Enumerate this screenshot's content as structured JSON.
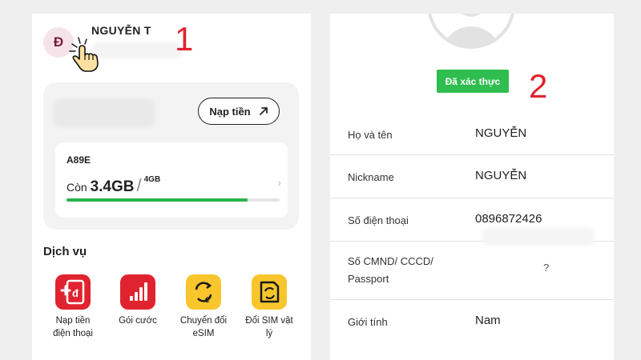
{
  "step_labels": [
    "1",
    "2"
  ],
  "panel1": {
    "avatar_initial": "Đ",
    "user_name": "NGUYỄN T",
    "topup_label": "Nạp tiền",
    "data_card": {
      "sim_code": "A89E",
      "remaining_prefix": "Còn",
      "remaining_value": "3.4GB",
      "total_value": "4GB",
      "progress_fraction": 0.85
    },
    "services_title": "Dịch vụ",
    "services": [
      {
        "label": "Nạp tiền\nđiện thoại",
        "icon": "topup-phone-icon",
        "color": "#e0242f"
      },
      {
        "label": "Gói cước",
        "icon": "signal-bars-icon",
        "color": "#e0242f"
      },
      {
        "label": "Chuyển đổi\neSIM",
        "icon": "esim-convert-icon",
        "color": "#f8c62c"
      },
      {
        "label": "Đổi SIM vật\nlý",
        "icon": "sim-swap-icon",
        "color": "#f8c62c"
      }
    ]
  },
  "panel2": {
    "verified_label": "Đã xác thực",
    "rows": [
      {
        "label": "Họ và tên",
        "value": "NGUYỄN"
      },
      {
        "label": "Nickname",
        "value": "NGUYỄN"
      },
      {
        "label": "Số điện thoại",
        "value": "0896872426"
      },
      {
        "label": "Số CMND/ CCCD/\nPassport",
        "value": "?"
      },
      {
        "label": "Giới tính",
        "value": "Nam"
      }
    ]
  },
  "colors": {
    "accent_red": "#e0242f",
    "verified_green": "#2ebd4e",
    "progress_green": "#2bb34a"
  }
}
